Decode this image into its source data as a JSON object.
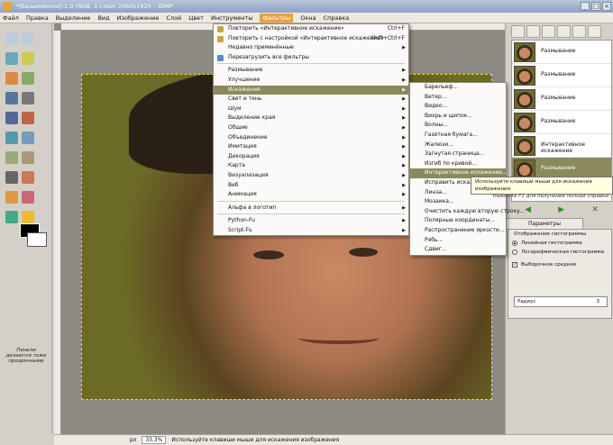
{
  "window": {
    "title": "*[Безымянное]-1.0 (RGB, 1 слой) 2560x1920 – GIMP"
  },
  "menubar": [
    "Файл",
    "Правка",
    "Выделение",
    "Вид",
    "Изображение",
    "Слой",
    "Цвет",
    "Инструменты",
    "Фильтры",
    "Окна",
    "Справка"
  ],
  "filters_menu": {
    "top": [
      {
        "label": "Повторить «Интерактивное искажение»",
        "shortcut": "Ctrl+F"
      },
      {
        "label": "Повторить с настройкой «Интерактивное искажение»",
        "shortcut": "Shift+Ctrl+F"
      },
      {
        "label": "Недавно применённые",
        "shortcut": ""
      },
      {
        "label": "Перезагрузить все фильтры",
        "shortcut": ""
      }
    ],
    "groups": [
      "Размывание",
      "Улучшение",
      "Искажения",
      "Свет и тень",
      "Шум",
      "Выделение края",
      "Общие",
      "Объединение",
      "Имитация",
      "Декорация",
      "Карта",
      "Визуализация",
      "Веб",
      "Анимация"
    ],
    "bottom": [
      "Альфа в логотип",
      "Python-Fu",
      "Script-Fu"
    ]
  },
  "distorts_menu": [
    "Барельеф...",
    "Ветер...",
    "Видео...",
    "Вихрь и щипок...",
    "Волны...",
    "Газетная бумага...",
    "Жалюзи...",
    "Загнутая страница...",
    "Изгиб по кривой...",
    "Интерактивное искажение...",
    "Исправить искажения объектива...",
    "Линза...",
    "Мозаика...",
    "Очистить каждую вторую строку...",
    "Полярные координаты...",
    "Распространение яркости...",
    "Рябь...",
    "Сдвиг..."
  ],
  "tooltip": {
    "line1": "Используйте клавиши мыши для искажения изображения",
    "line2": "Нажмите F1 для получения полной справки"
  },
  "history": [
    "Размывание",
    "Размывание",
    "Размывание",
    "Размывание",
    "Интерактивное искажение",
    "Размывание"
  ],
  "tool_options": {
    "tab_label": "Параметры инструментов",
    "section": "Отображение гистограммы",
    "radio_linear": "Линейная гистограмма",
    "radio_log": "Логарифмическая гистограмма",
    "checkbox": "Выборочное среднее",
    "radius_label": "Радиус",
    "radius_value": "3"
  },
  "statusbar": {
    "unit": "px",
    "zoom": "33,3%",
    "message": "Используйте клавиши мыши для искажения изображения"
  },
  "toolbox_hint": "Панели делаются тоже прозрачными"
}
